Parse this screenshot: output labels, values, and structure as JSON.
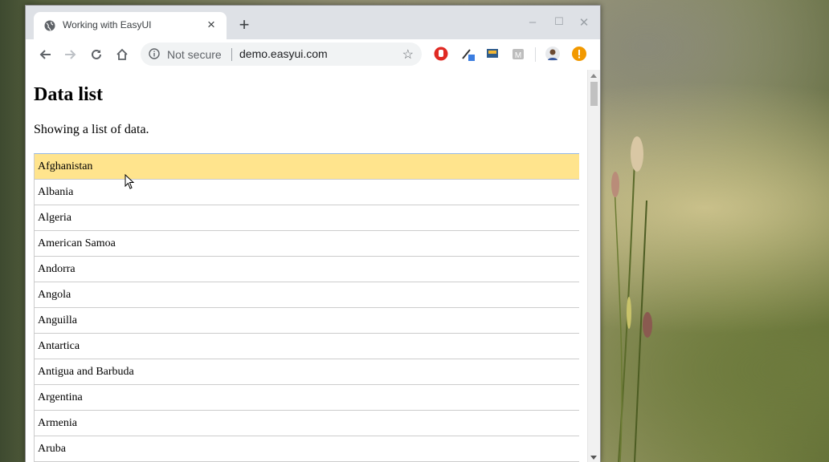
{
  "browser": {
    "tab_title": "Working with EasyUI",
    "tab_close": "×",
    "new_tab": "+",
    "window_controls": {
      "minimize": "–",
      "maximize": "☐",
      "close": "✕"
    },
    "security_label": "Not secure",
    "url": "demo.easyui.com",
    "icons": [
      "back-icon",
      "forward-icon",
      "reload-icon",
      "home-icon",
      "info-icon",
      "star-icon"
    ],
    "extensions": [
      "stop-hand-icon",
      "eyedropper-icon",
      "screen-icon",
      "m-extension-icon",
      "profile-avatar",
      "alert-icon"
    ]
  },
  "page": {
    "heading": "Data list",
    "description": "Showing a list of data.",
    "items": [
      "Afghanistan",
      "Albania",
      "Algeria",
      "American Samoa",
      "Andorra",
      "Angola",
      "Anguilla",
      "Antartica",
      "Antigua and Barbuda",
      "Argentina",
      "Armenia",
      "Aruba"
    ],
    "selected_index": 0
  },
  "colors": {
    "selected_row": "#ffe48d",
    "list_border": "#95b8e7",
    "tabstrip": "#dee1e6"
  }
}
